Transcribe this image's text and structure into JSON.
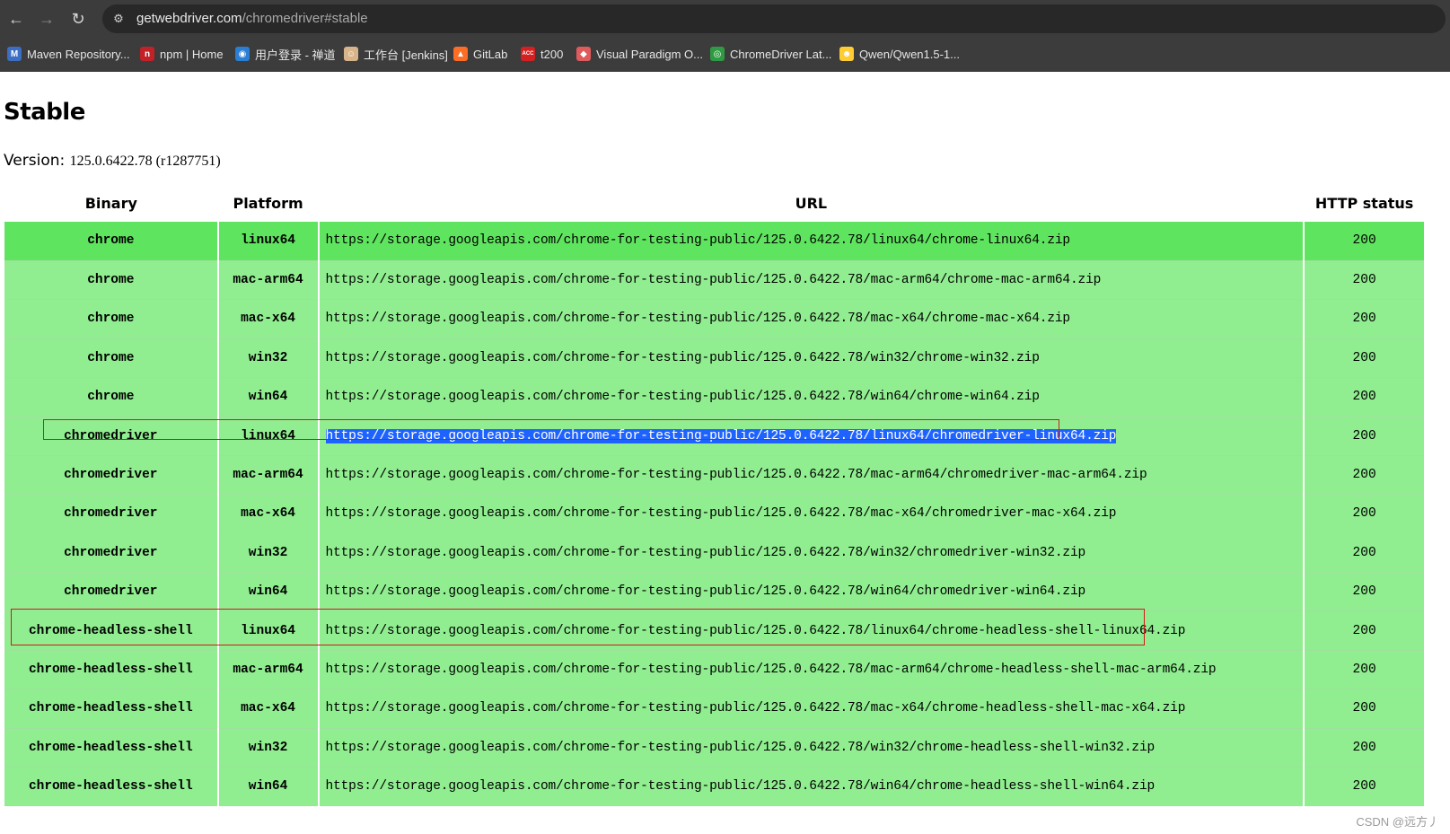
{
  "browser": {
    "url_host": "getwebdriver.com",
    "url_path": "/chromedriver#stable",
    "bookmarks": [
      {
        "label": "Maven Repository...",
        "icon": "maven-icon",
        "color": "#3c6ec4"
      },
      {
        "label": "npm | Home",
        "icon": "npm-icon",
        "color": "#c12127"
      },
      {
        "label": "用户登录 - 禅道",
        "icon": "zentao-icon",
        "color": "#2a7fd4"
      },
      {
        "label": "工作台 [Jenkins]",
        "icon": "jenkins-icon",
        "color": "#d8b48a"
      },
      {
        "label": "GitLab",
        "icon": "gitlab-icon",
        "color": "#fc6d26"
      },
      {
        "label": "t200",
        "icon": "acc-icon",
        "color": "#d42020"
      },
      {
        "label": "Visual Paradigm O...",
        "icon": "visual-paradigm-icon",
        "color": "#e05b5b"
      },
      {
        "label": "ChromeDriver Lat...",
        "icon": "chrome-icon",
        "color": "#2f9a43"
      },
      {
        "label": "Qwen/Qwen1.5-1...",
        "icon": "huggingface-icon",
        "color": "#ffcc33"
      }
    ]
  },
  "page": {
    "title": "Stable",
    "version_label": "Version:",
    "version_value": "125.0.6422.78 (r1287751)"
  },
  "table": {
    "headers": [
      "Binary",
      "Platform",
      "URL",
      "HTTP status"
    ],
    "rows": [
      {
        "binary": "chrome",
        "platform": "linux64",
        "url": "https://storage.googleapis.com/chrome-for-testing-public/125.0.6422.78/linux64/chrome-linux64.zip",
        "status": "200"
      },
      {
        "binary": "chrome",
        "platform": "mac-arm64",
        "url": "https://storage.googleapis.com/chrome-for-testing-public/125.0.6422.78/mac-arm64/chrome-mac-arm64.zip",
        "status": "200"
      },
      {
        "binary": "chrome",
        "platform": "mac-x64",
        "url": "https://storage.googleapis.com/chrome-for-testing-public/125.0.6422.78/mac-x64/chrome-mac-x64.zip",
        "status": "200"
      },
      {
        "binary": "chrome",
        "platform": "win32",
        "url": "https://storage.googleapis.com/chrome-for-testing-public/125.0.6422.78/win32/chrome-win32.zip",
        "status": "200"
      },
      {
        "binary": "chrome",
        "platform": "win64",
        "url": "https://storage.googleapis.com/chrome-for-testing-public/125.0.6422.78/win64/chrome-win64.zip",
        "status": "200"
      },
      {
        "binary": "chromedriver",
        "platform": "linux64",
        "url": "https://storage.googleapis.com/chrome-for-testing-public/125.0.6422.78/linux64/chromedriver-linux64.zip",
        "status": "200"
      },
      {
        "binary": "chromedriver",
        "platform": "mac-arm64",
        "url": "https://storage.googleapis.com/chrome-for-testing-public/125.0.6422.78/mac-arm64/chromedriver-mac-arm64.zip",
        "status": "200"
      },
      {
        "binary": "chromedriver",
        "platform": "mac-x64",
        "url": "https://storage.googleapis.com/chrome-for-testing-public/125.0.6422.78/mac-x64/chromedriver-mac-x64.zip",
        "status": "200"
      },
      {
        "binary": "chromedriver",
        "platform": "win32",
        "url": "https://storage.googleapis.com/chrome-for-testing-public/125.0.6422.78/win32/chromedriver-win32.zip",
        "status": "200"
      },
      {
        "binary": "chromedriver",
        "platform": "win64",
        "url": "https://storage.googleapis.com/chrome-for-testing-public/125.0.6422.78/win64/chromedriver-win64.zip",
        "status": "200"
      },
      {
        "binary": "chrome-headless-shell",
        "platform": "linux64",
        "url": "https://storage.googleapis.com/chrome-for-testing-public/125.0.6422.78/linux64/chrome-headless-shell-linux64.zip",
        "status": "200"
      },
      {
        "binary": "chrome-headless-shell",
        "platform": "mac-arm64",
        "url": "https://storage.googleapis.com/chrome-for-testing-public/125.0.6422.78/mac-arm64/chrome-headless-shell-mac-arm64.zip",
        "status": "200"
      },
      {
        "binary": "chrome-headless-shell",
        "platform": "mac-x64",
        "url": "https://storage.googleapis.com/chrome-for-testing-public/125.0.6422.78/mac-x64/chrome-headless-shell-mac-x64.zip",
        "status": "200"
      },
      {
        "binary": "chrome-headless-shell",
        "platform": "win32",
        "url": "https://storage.googleapis.com/chrome-for-testing-public/125.0.6422.78/win32/chrome-headless-shell-win32.zip",
        "status": "200"
      },
      {
        "binary": "chrome-headless-shell",
        "platform": "win64",
        "url": "https://storage.googleapis.com/chrome-for-testing-public/125.0.6422.78/win64/chrome-headless-shell-win64.zip",
        "status": "200"
      }
    ]
  },
  "colors": {
    "row_green": "#90ee90",
    "first_row_green": "#5fe45f",
    "selection_blue": "#1f63ff",
    "annotation_red": "#d11a1a"
  },
  "watermark": "CSDN @远方丿"
}
